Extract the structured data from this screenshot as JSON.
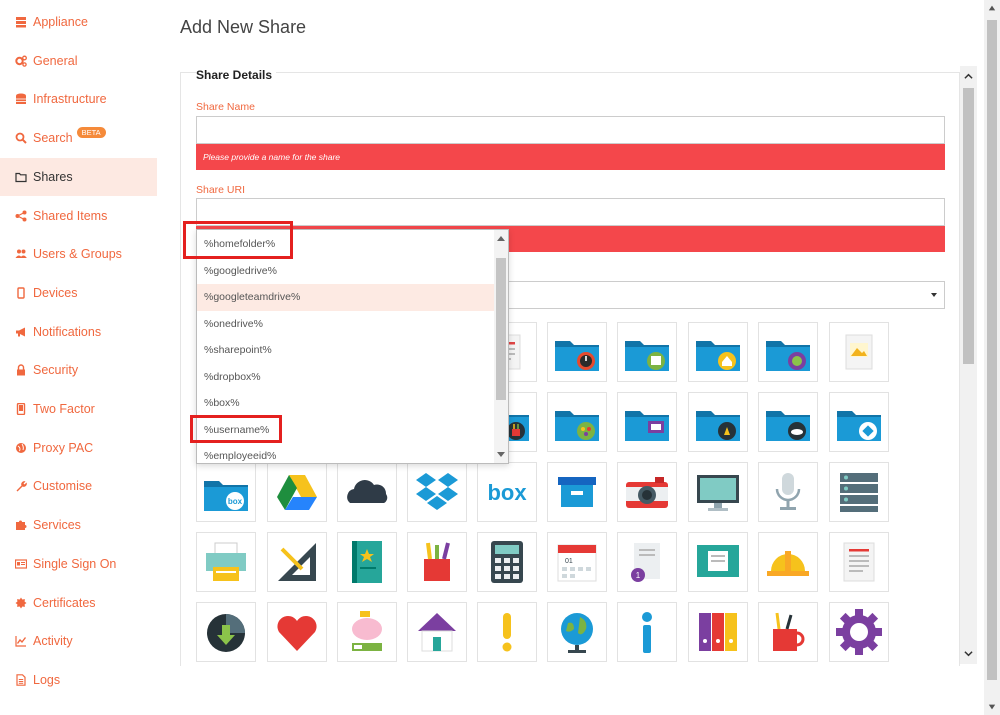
{
  "page": {
    "title": "Add New Share"
  },
  "sidebar": {
    "items": [
      {
        "label": "Appliance",
        "icon": "server-icon",
        "active": false
      },
      {
        "label": "General",
        "icon": "gears-icon",
        "active": false
      },
      {
        "label": "Infrastructure",
        "icon": "database-icon",
        "active": false
      },
      {
        "label": "Search",
        "icon": "search-icon",
        "active": false,
        "badge": "BETA"
      },
      {
        "label": "Shares",
        "icon": "folder-icon",
        "active": true
      },
      {
        "label": "Shared Items",
        "icon": "share-icon",
        "active": false
      },
      {
        "label": "Users & Groups",
        "icon": "users-icon",
        "active": false
      },
      {
        "label": "Devices",
        "icon": "mobile-icon",
        "active": false
      },
      {
        "label": "Notifications",
        "icon": "bullhorn-icon",
        "active": false
      },
      {
        "label": "Security",
        "icon": "lock-icon",
        "active": false
      },
      {
        "label": "Two Factor",
        "icon": "phone-icon",
        "active": false
      },
      {
        "label": "Proxy PAC",
        "icon": "globe-icon",
        "active": false
      },
      {
        "label": "Customise",
        "icon": "wrench-icon",
        "active": false
      },
      {
        "label": "Services",
        "icon": "puzzle-icon",
        "active": false
      },
      {
        "label": "Single Sign On",
        "icon": "id-card-icon",
        "active": false
      },
      {
        "label": "Certificates",
        "icon": "certificate-icon",
        "active": false
      },
      {
        "label": "Activity",
        "icon": "chart-line-icon",
        "active": false
      },
      {
        "label": "Logs",
        "icon": "file-text-icon",
        "active": false
      }
    ]
  },
  "form": {
    "section_title": "Share Details",
    "share_name_label": "Share Name",
    "share_name_value": "",
    "share_name_error": "Please provide a name for the share",
    "share_uri_label": "Share URI",
    "share_uri_value": ""
  },
  "uri_dropdown": {
    "options": [
      "%homefolder%",
      "%googledrive%",
      "%googleteamdrive%",
      "%onedrive%",
      "%sharepoint%",
      "%dropbox%",
      "%box%",
      "%username%",
      "%employeeid%"
    ],
    "highlighted": "%googleteamdrive%",
    "marked": [
      "%homefolder%",
      "%username%"
    ]
  },
  "colors": {
    "accent": "#f0683f",
    "error": "#f4474b",
    "active_nav": "#fde9e2",
    "folder_blue": "#1b9ad6",
    "marker_red": "#e4201f"
  },
  "icon_grid": {
    "rows": [
      [
        "document-icon",
        "folder-clock-icon",
        "folder-photos-icon",
        "folder-home-icon",
        "folder-globe-icon",
        "photo-document-icon"
      ],
      [
        "folder-pencils-icon",
        "folder-team-icon",
        "folder-video-icon",
        "folder-google-drive-icon",
        "folder-onedrive-icon",
        "folder-dropbox-icon"
      ],
      [
        "folder-box-icon",
        "google-drive-icon",
        "onedrive-cloud-icon",
        "dropbox-icon",
        "box-logo-icon",
        "archive-box-icon",
        "camera-icon",
        "monitor-icon",
        "microphone-icon",
        "server-rack-icon"
      ],
      [
        "printer-icon",
        "ruler-pencil-icon",
        "notebook-icon",
        "pencil-cup-icon",
        "calculator-icon",
        "calendar-icon",
        "numbered-document-icon",
        "chalkboard-icon",
        "hard-hat-icon",
        "report-icon"
      ],
      [
        "download-clock-icon",
        "heart-icon",
        "piggy-bank-icon",
        "house-icon",
        "exclamation-icon",
        "desk-globe-icon",
        "info-icon",
        "binders-icon",
        "pencil-mug-icon",
        "gear-icon"
      ]
    ]
  }
}
